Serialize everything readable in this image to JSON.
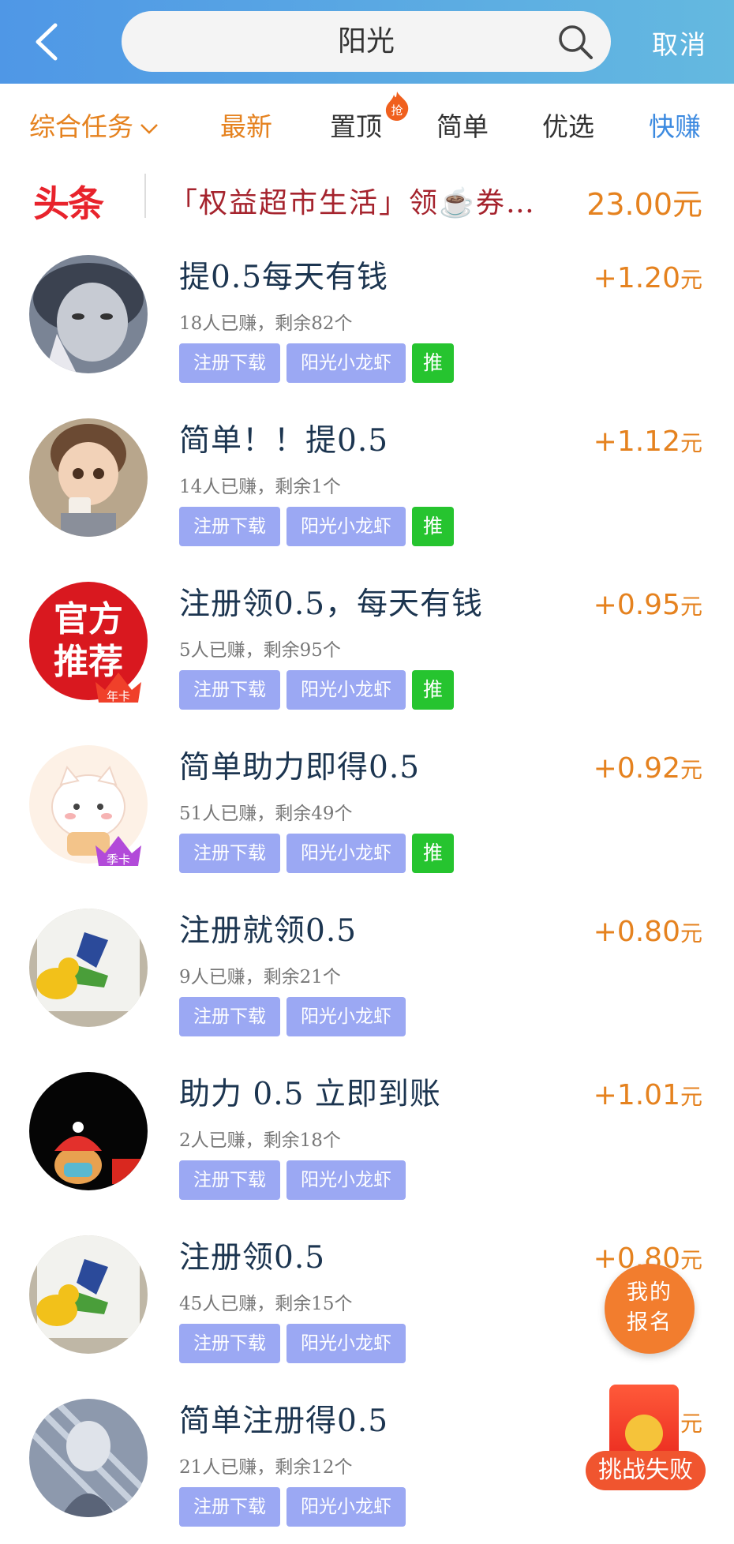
{
  "header": {
    "search_value": "阳光",
    "cancel_label": "取消"
  },
  "tabs": [
    {
      "label": "综合任务",
      "color": "#e5821f"
    },
    {
      "label": "最新",
      "color": "#e5821f"
    },
    {
      "label": "置顶",
      "badge": "抢"
    },
    {
      "label": "简单"
    },
    {
      "label": "优选"
    },
    {
      "label": "快赚",
      "color": "#3c8ae0"
    }
  ],
  "headline": {
    "logo": "头条",
    "text": "「权益超市生活」领☕券…",
    "amount": "23.00元"
  },
  "items": [
    {
      "title": "提0.5每天有钱",
      "price": "+1.20",
      "unit": "元",
      "stats": "18人已赚，剩余82个",
      "tags": [
        "注册下载",
        "阳光小龙虾"
      ],
      "recommend": "推"
    },
    {
      "title": "简单！！提0.5",
      "price": "+1.12",
      "unit": "元",
      "stats": "14人已赚，剩余1个",
      "tags": [
        "注册下载",
        "阳光小龙虾"
      ],
      "recommend": "推"
    },
    {
      "title": "注册领0.5，每天有钱",
      "price": "+0.95",
      "unit": "元",
      "stats": "5人已赚，剩余95个",
      "tags": [
        "注册下载",
        "阳光小龙虾"
      ],
      "recommend": "推",
      "avatar_text": [
        "官方",
        "推荐"
      ],
      "crown": "年卡"
    },
    {
      "title": "简单助力即得0.5",
      "price": "+0.92",
      "unit": "元",
      "stats": "51人已赚，剩余49个",
      "tags": [
        "注册下载",
        "阳光小龙虾"
      ],
      "recommend": "推",
      "crown": "季卡"
    },
    {
      "title": "注册就领0.5",
      "price": "+0.80",
      "unit": "元",
      "stats": "9人已赚，剩余21个",
      "tags": [
        "注册下载",
        "阳光小龙虾"
      ]
    },
    {
      "title": "助力 0.5 立即到账",
      "price": "+1.01",
      "unit": "元",
      "stats": "2人已赚，剩余18个",
      "tags": [
        "注册下载",
        "阳光小龙虾"
      ]
    },
    {
      "title": "注册领0.5",
      "price": "+0.80",
      "unit": "元",
      "stats": "45人已赚，剩余15个",
      "tags": [
        "注册下载",
        "阳光小龙虾"
      ]
    },
    {
      "title": "简单注册得0.5",
      "price": "",
      "unit": "元",
      "stats": "21人已赚，剩余12个",
      "tags": [
        "注册下载",
        "阳光小龙虾"
      ]
    }
  ],
  "floating": {
    "my_signup": [
      "我的",
      "报名"
    ],
    "challenge_failed": "挑战失败"
  },
  "colors": {
    "header_gradient_start": "#4f97e6",
    "header_gradient_end": "#64b9e0",
    "accent_orange": "#e5821f",
    "accent_blue": "#3c8ae0",
    "tag_blue": "#9ba8f3",
    "tag_green": "#26c42f",
    "headline_red": "#a5232d"
  }
}
